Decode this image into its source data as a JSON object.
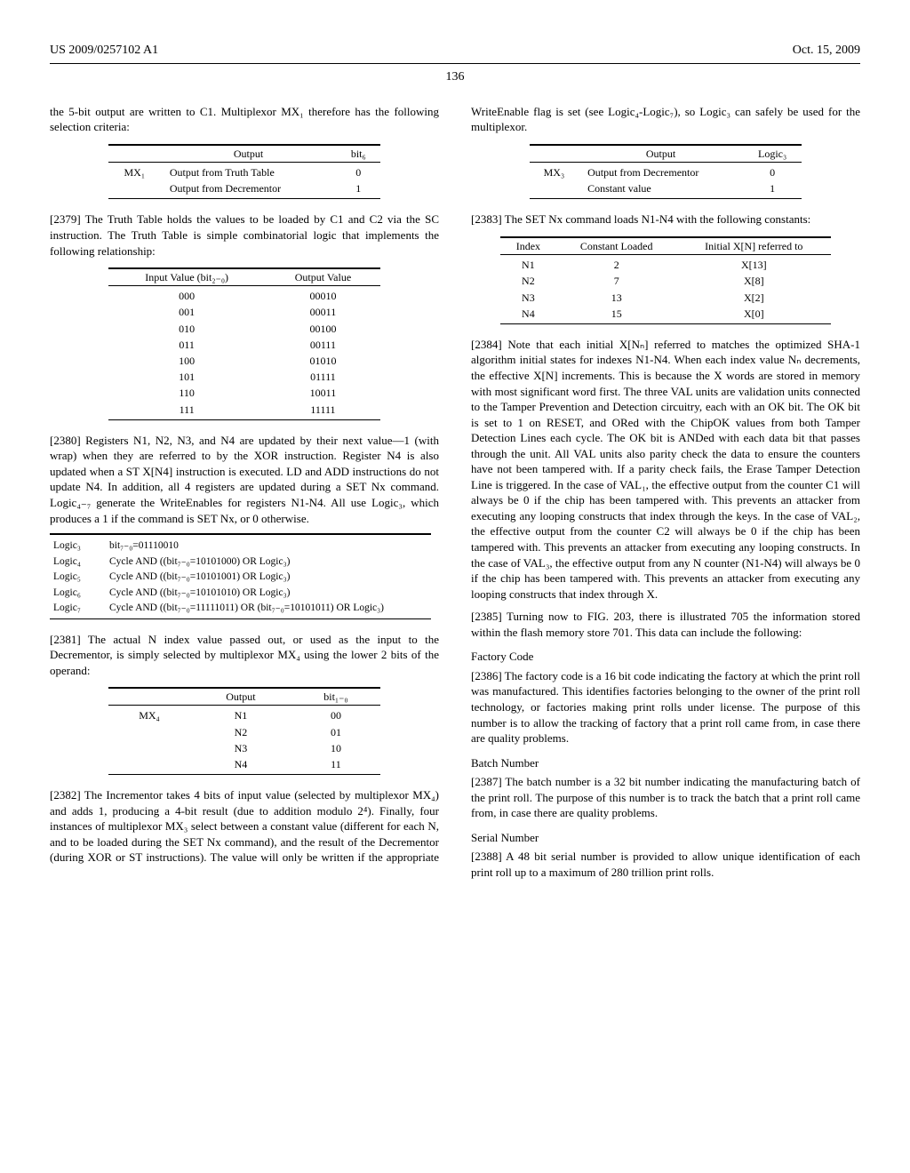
{
  "header": {
    "left": "US 2009/0257102 A1",
    "right": "Oct. 15, 2009",
    "pageNumber": "136"
  },
  "col1": {
    "introPara": "the 5-bit output are written to C1. Multiplexor MX₁ therefore has the following selection criteria:",
    "tableMX1": {
      "headers": [
        "",
        "Output",
        "bit₆"
      ],
      "rows": [
        [
          "MX₁",
          "Output from Truth Table",
          "0"
        ],
        [
          "",
          "Output from Decrementor",
          "1"
        ]
      ]
    },
    "para2379": "[2379]   The Truth Table holds the values to be loaded by C1 and C2 via the SC instruction. The Truth Table is simple combinatorial logic that implements the following relationship:",
    "tableTruth": {
      "headers": [
        "Input Value (bit₂₋₀)",
        "Output Value"
      ],
      "rows": [
        [
          "000",
          "00010"
        ],
        [
          "001",
          "00011"
        ],
        [
          "010",
          "00100"
        ],
        [
          "011",
          "00111"
        ],
        [
          "100",
          "01010"
        ],
        [
          "101",
          "01111"
        ],
        [
          "110",
          "10011"
        ],
        [
          "111",
          "11111"
        ]
      ]
    },
    "para2380": "[2380]   Registers N1, N2, N3, and N4 are updated by their next value—1 (with wrap) when they are referred to by the XOR instruction. Register N4 is also updated when a ST X[N4] instruction is executed. LD and ADD instructions do not update N4. In addition, all 4 registers are updated during a SET Nx command. Logic₄₋₇ generate the WriteEnables for registers N1-N4. All use Logic₃, which produces a 1 if the command is SET Nx, or 0 otherwise.",
    "tableLogic": {
      "rows": [
        [
          "Logic₃",
          "bit₇₋₀=01110010"
        ],
        [
          "Logic₄",
          "Cycle AND ((bit₇₋₀=10101000) OR Logic₃)"
        ],
        [
          "Logic₅",
          "Cycle AND ((bit₇₋₀=10101001) OR Logic₃)"
        ],
        [
          "Logic₆",
          "Cycle AND ((bit₇₋₀=10101010) OR Logic₃)"
        ],
        [
          "Logic₇",
          "Cycle AND ((bit₇₋₀=11111011) OR (bit₇₋₀=10101011) OR Logic₃)"
        ]
      ]
    },
    "para2381": "[2381]   The actual N index value passed out, or used as the input to the Decrementor, is simply selected by multiplexor MX₄ using the lower 2 bits of the operand:",
    "tableMX4": {
      "headers": [
        "",
        "Output",
        "bit₁₋₀"
      ],
      "rows": [
        [
          "MX₄",
          "N1",
          "00"
        ],
        [
          "",
          "N2",
          "01"
        ],
        [
          "",
          "N3",
          "10"
        ],
        [
          "",
          "N4",
          "11"
        ]
      ]
    },
    "para2382": "[2382]   The Incrementor takes 4 bits of input value (selected by multiplexor MX₄) and adds 1, producing a 4-bit result (due to addition modulo 2⁴). Finally, four instances of multiplexor MX₃ select between a constant value (different for each N, and to be loaded during the SET Nx command), and the result of the Decrementor (during XOR or ST instructions). The value will only be written if the appropriate WriteEnable flag is set (see Logic₄-Logic₇), so Logic₃ can safely be used for the multiplexor."
  },
  "col2": {
    "tableMX3": {
      "headers": [
        "",
        "Output",
        "Logic₃"
      ],
      "rows": [
        [
          "MX₃",
          "Output from Decrementor",
          "0"
        ],
        [
          "",
          "Constant value",
          "1"
        ]
      ]
    },
    "para2383": "[2383]   The SET Nx command loads N1-N4 with the following constants:",
    "tableConstants": {
      "headers": [
        "Index",
        "Constant Loaded",
        "Initial X[N] referred to"
      ],
      "rows": [
        [
          "N1",
          "2",
          "X[13]"
        ],
        [
          "N2",
          "7",
          "X[8]"
        ],
        [
          "N3",
          "13",
          "X[2]"
        ],
        [
          "N4",
          "15",
          "X[0]"
        ]
      ]
    },
    "para2384": "[2384]   Note that each initial X[Nₙ] referred to matches the optimized SHA-1 algorithm initial states for indexes N1-N4. When each index value Nₙ decrements, the effective X[N] increments. This is because the X words are stored in memory with most significant word first. The three VAL units are validation units connected to the Tamper Prevention and Detection circuitry, each with an OK bit. The OK bit is set to 1 on RESET, and ORed with the ChipOK values from both Tamper Detection Lines each cycle. The OK bit is ANDed with each data bit that passes through the unit. All VAL units also parity check the data to ensure the counters have not been tampered with. If a parity check fails, the Erase Tamper Detection Line is triggered. In the case of VAL₁, the effective output from the counter C1 will always be 0 if the chip has been tampered with. This prevents an attacker from executing any looping constructs that index through the keys. In the case of VAL₂, the effective output from the counter C2 will always be 0 if the chip has been tampered with. This prevents an attacker from executing any looping constructs. In the case of VAL₃, the effective output from any N counter (N1-N4) will always be 0 if the chip has been tampered with. This prevents an attacker from executing any looping constructs that index through X.",
    "para2385": "[2385]   Turning now to FIG. 203, there is illustrated 705 the information stored within the flash memory store 701. This data can include the following:",
    "headingFactory": "Factory Code",
    "para2386": "[2386]   The factory code is a 16 bit code indicating the factory at which the print roll was manufactured. This identifies factories belonging to the owner of the print roll technology, or factories making print rolls under license. The purpose of this number is to allow the tracking of factory that a print roll came from, in case there are quality problems.",
    "headingBatch": "Batch Number",
    "para2387": "[2387]   The batch number is a 32 bit number indicating the manufacturing batch of the print roll. The purpose of this number is to track the batch that a print roll came from, in case there are quality problems.",
    "headingSerial": "Serial Number",
    "para2388": "[2388]   A 48 bit serial number is provided to allow unique identification of each print roll up to a maximum of 280 trillion print rolls."
  }
}
